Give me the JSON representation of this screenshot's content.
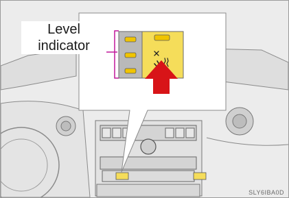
{
  "callout": {
    "line1": "Level",
    "line2": "indicator"
  },
  "figure_code": "SLY6IBA0D",
  "colors": {
    "level_indicator": "#f0c400",
    "switch_face": "#f5dd5a",
    "arrow": "#d81418",
    "leader_line": "#c0169a"
  },
  "icons": [
    "seat-heater-icon"
  ]
}
